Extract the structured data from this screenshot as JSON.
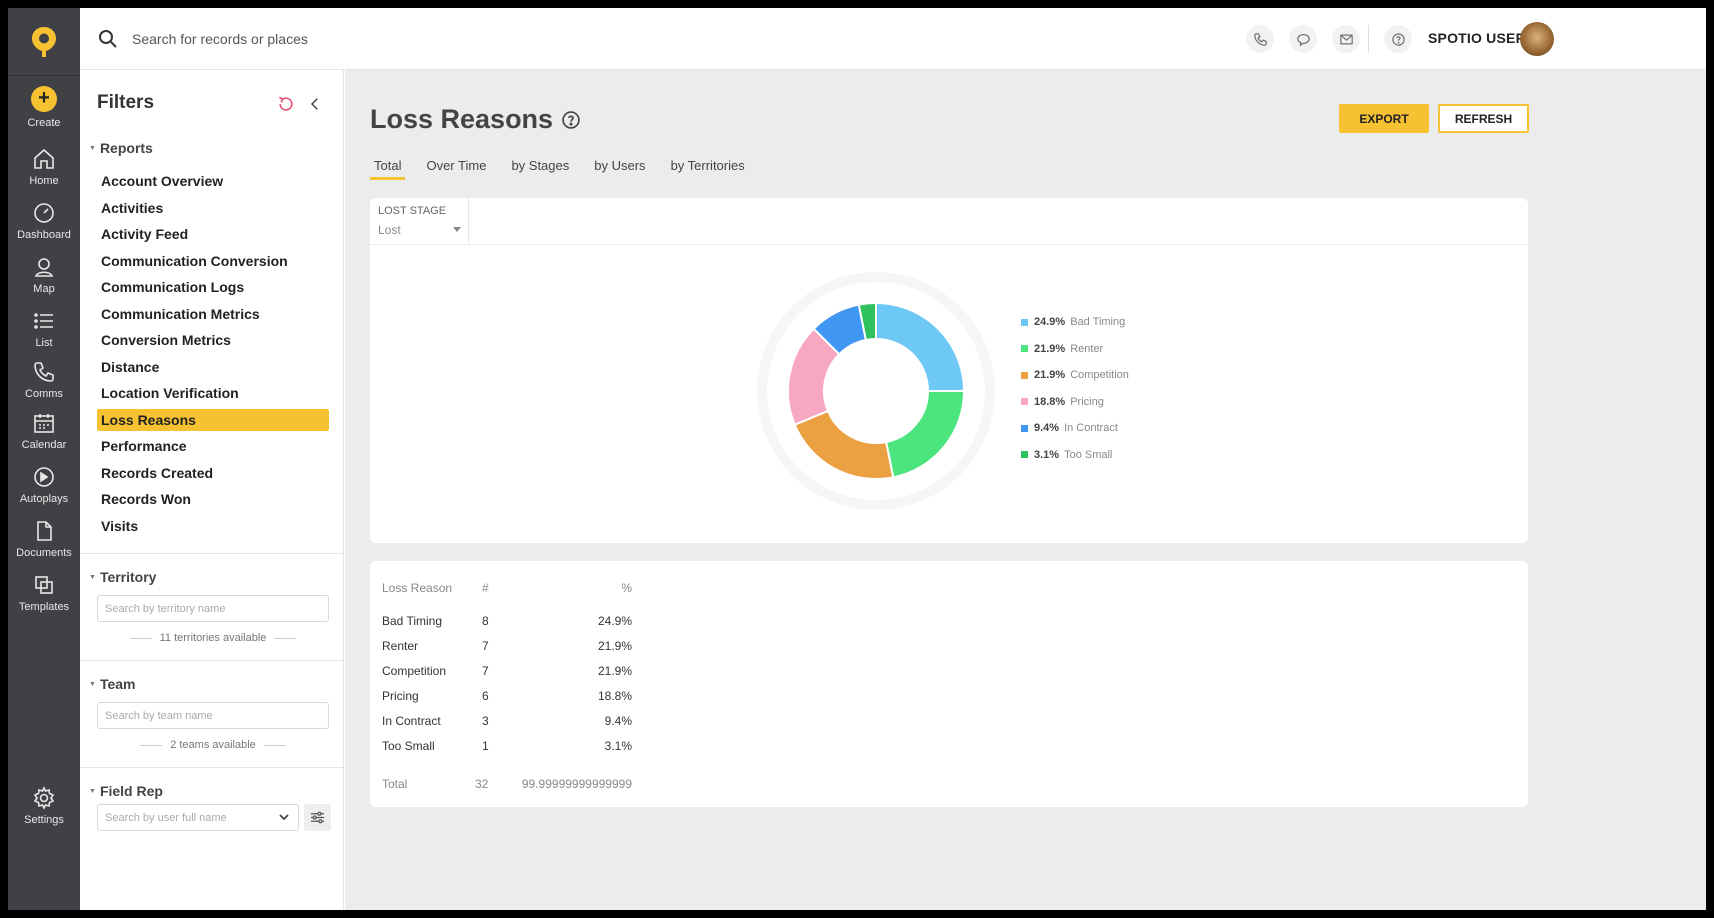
{
  "rail": {
    "create": "Create",
    "items": [
      "Home",
      "Dashboard",
      "Map",
      "List",
      "Comms",
      "Calendar",
      "Autoplays",
      "Documents",
      "Templates"
    ],
    "settings": "Settings"
  },
  "topbar": {
    "search_placeholder": "Search for records or places",
    "user_name": "SPOTIO USER"
  },
  "filters": {
    "title": "Filters",
    "reports_heading": "Reports",
    "reports": [
      "Account Overview",
      "Activities",
      "Activity Feed",
      "Communication Conversion",
      "Communication Logs",
      "Communication Metrics",
      "Conversion Metrics",
      "Distance",
      "Location Verification",
      "Loss Reasons",
      "Performance",
      "Records Created",
      "Records Won",
      "Visits"
    ],
    "active_report": "Loss Reasons",
    "territory": {
      "heading": "Territory",
      "placeholder": "Search by territory name",
      "available": "11 territories available"
    },
    "team": {
      "heading": "Team",
      "placeholder": "Search by team name",
      "available": "2 teams available"
    },
    "field_rep": {
      "heading": "Field Rep",
      "placeholder": "Search by user full name"
    }
  },
  "main": {
    "title": "Loss Reasons",
    "export_label": "EXPORT",
    "refresh_label": "REFRESH",
    "tabs": [
      "Total",
      "Over Time",
      "by Stages",
      "by Users",
      "by Territories"
    ],
    "active_tab": "Total",
    "lost_stage": {
      "label": "LOST STAGE",
      "value": "Lost"
    }
  },
  "chart_data": {
    "type": "pie",
    "donut": true,
    "categories": [
      "Bad Timing",
      "Renter",
      "Competition",
      "Pricing",
      "In Contract",
      "Too Small"
    ],
    "values": [
      8,
      7,
      7,
      6,
      3,
      1
    ],
    "percent_labels": [
      "24.9%",
      "21.9%",
      "21.9%",
      "18.8%",
      "9.4%",
      "3.1%"
    ],
    "colors": [
      "#6ec8f5",
      "#4ce47c",
      "#eba041",
      "#f8a7c0",
      "#3f97f3",
      "#2fc15b"
    ],
    "legend_position": "right"
  },
  "table": {
    "headers": [
      "Loss Reason",
      "#",
      "%"
    ],
    "rows": [
      [
        "Bad Timing",
        "8",
        "24.9%"
      ],
      [
        "Renter",
        "7",
        "21.9%"
      ],
      [
        "Competition",
        "7",
        "21.9%"
      ],
      [
        "Pricing",
        "6",
        "18.8%"
      ],
      [
        "In Contract",
        "3",
        "9.4%"
      ],
      [
        "Too Small",
        "1",
        "3.1%"
      ]
    ],
    "total": [
      "Total",
      "32",
      "99.99999999999999"
    ]
  },
  "colors": {
    "accent": "#f6c232",
    "rail": "#3f4145"
  }
}
